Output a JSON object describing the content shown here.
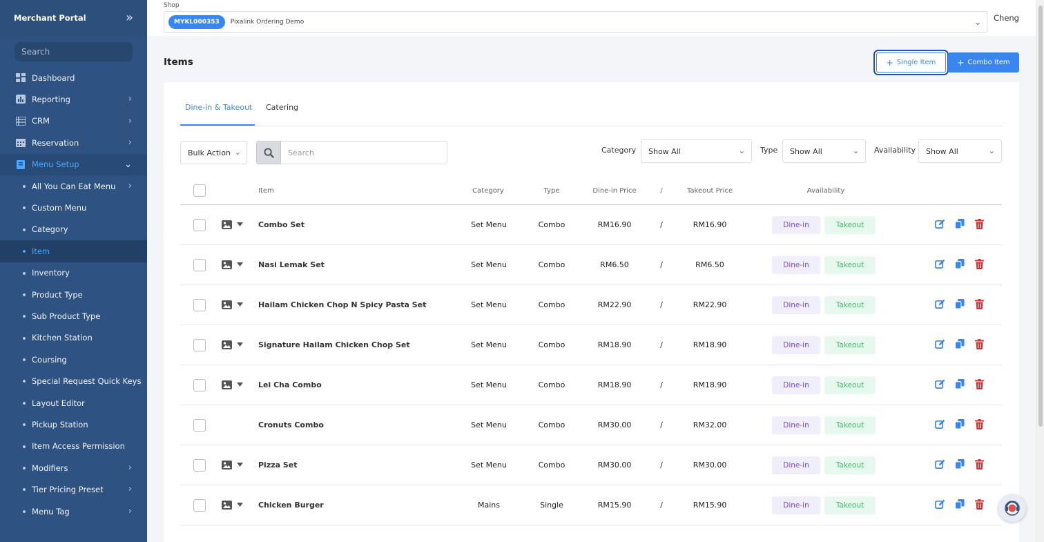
{
  "sidebar": {
    "title": "Merchant Portal",
    "search_placeholder": "Search",
    "items": [
      {
        "label": "Dashboard"
      },
      {
        "label": "Reporting"
      },
      {
        "label": "CRM"
      },
      {
        "label": "Reservation"
      },
      {
        "label": "Menu Setup"
      }
    ],
    "subitems": [
      {
        "label": "All You Can Eat Menu"
      },
      {
        "label": "Custom Menu"
      },
      {
        "label": "Category"
      },
      {
        "label": "Item"
      },
      {
        "label": "Inventory"
      },
      {
        "label": "Product Type"
      },
      {
        "label": "Sub Product Type"
      },
      {
        "label": "Kitchen Station"
      },
      {
        "label": "Coursing"
      },
      {
        "label": "Special Request Quick Keys"
      },
      {
        "label": "Layout Editor"
      },
      {
        "label": "Pickup Station"
      },
      {
        "label": "Item Access Permission"
      },
      {
        "label": "Modifiers"
      },
      {
        "label": "Tier Pricing Preset"
      },
      {
        "label": "Menu Tag"
      }
    ]
  },
  "shop": {
    "label": "Shop",
    "code": "MYKL000353",
    "name": "Pixalink Ordering Demo",
    "user": "Cheng"
  },
  "page": {
    "title": "Items",
    "single_item_label": "Single Item",
    "combo_item_label": "Combo Item"
  },
  "tabs": {
    "dine_in": "Dine-in & Takeout",
    "catering": "Catering"
  },
  "filters": {
    "bulk_action": "Bulk Action",
    "search_placeholder": "Search",
    "category_label": "Category",
    "category_value": "Show All",
    "type_label": "Type",
    "type_value": "Show All",
    "availability_label": "Availability",
    "availability_value": "Show All"
  },
  "table": {
    "headers": {
      "item": "Item",
      "category": "Category",
      "type": "Type",
      "dine_price": "Dine-in Price",
      "sep": "/",
      "takeout_price": "Takeout Price",
      "availability": "Availability"
    },
    "badge_dine": "Dine-in",
    "badge_take": "Takeout",
    "rows": [
      {
        "name": "Combo Set",
        "category": "Set Menu",
        "type": "Combo",
        "dine": "RM16.90",
        "sep": "/",
        "take": "RM16.90"
      },
      {
        "name": "Nasi Lemak Set",
        "category": "Set Menu",
        "type": "Combo",
        "dine": "RM6.50",
        "sep": "/",
        "take": "RM6.50"
      },
      {
        "name": "Hailam Chicken Chop N Spicy Pasta Set",
        "category": "Set Menu",
        "type": "Combo",
        "dine": "RM22.90",
        "sep": "/",
        "take": "RM22.90"
      },
      {
        "name": "Signature Hailam Chicken Chop Set",
        "category": "Set Menu",
        "type": "Combo",
        "dine": "RM18.90",
        "sep": "/",
        "take": "RM18.90"
      },
      {
        "name": "Lei Cha Combo",
        "category": "Set Menu",
        "type": "Combo",
        "dine": "RM18.90",
        "sep": "/",
        "take": "RM18.90"
      },
      {
        "name": "Cronuts Combo",
        "category": "Set Menu",
        "type": "Combo",
        "dine": "RM30.00",
        "sep": "/",
        "take": "RM32.00"
      },
      {
        "name": "Pizza Set",
        "category": "Set Menu",
        "type": "Combo",
        "dine": "RM30.00",
        "sep": "/",
        "take": "RM30.00"
      },
      {
        "name": "Chicken Burger",
        "category": "Mains",
        "type": "Single",
        "dine": "RM15.90",
        "sep": "/",
        "take": "RM15.90"
      }
    ]
  },
  "colors": {
    "sidebar_bg": "#2e5281",
    "accent": "#3a86f0",
    "dine_badge": "#7a4bd1",
    "takeout_badge": "#41b86a",
    "delete": "#d32f2f"
  }
}
